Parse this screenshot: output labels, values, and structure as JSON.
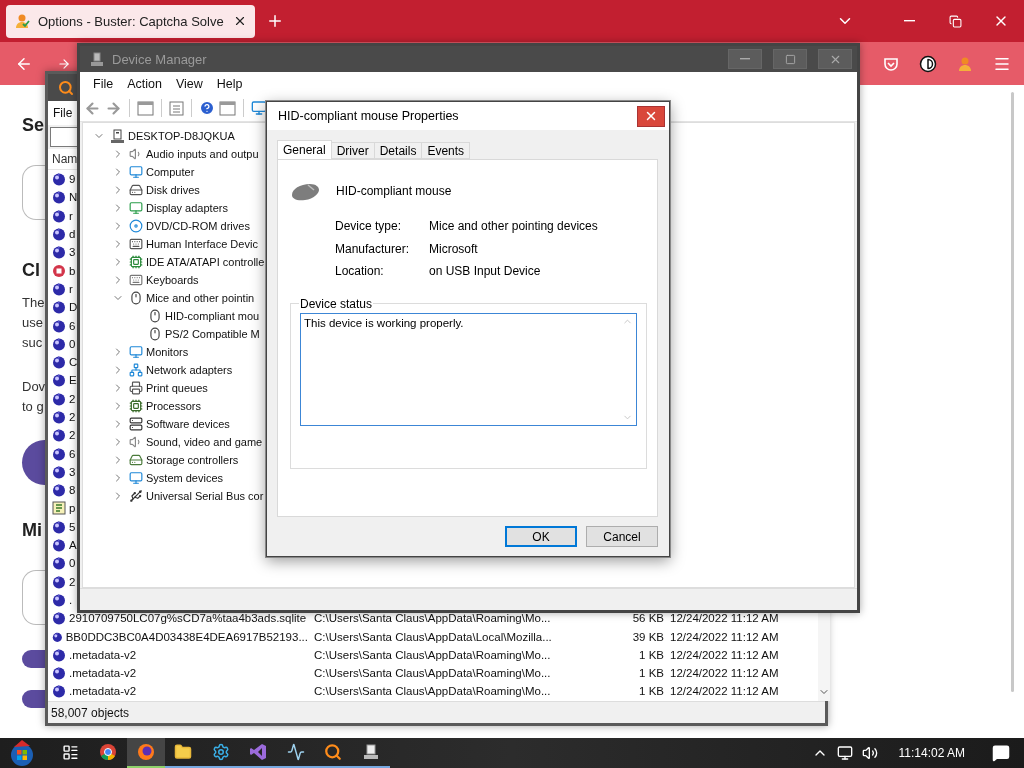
{
  "browser": {
    "tabs": [
      {
        "title": "Options - Buster: Captcha Solve",
        "selected": true
      }
    ],
    "page": {
      "heading_1": "Se",
      "heading_2": "Cl",
      "paragraph_1": [
        "The",
        "use",
        "suc"
      ],
      "paragraph_2": [
        "Dov",
        "to g"
      ],
      "heading_3": "Mi"
    }
  },
  "everything": {
    "menu": [
      "File"
    ],
    "columns": [
      "Nam"
    ],
    "rows": [
      {
        "kind": "database",
        "name": "9"
      },
      {
        "kind": "database",
        "name": "N"
      },
      {
        "kind": "database",
        "name": "r"
      },
      {
        "kind": "database",
        "name": "d"
      },
      {
        "kind": "database",
        "name": "3"
      },
      {
        "kind": "app",
        "name": "b"
      },
      {
        "kind": "database",
        "name": "r"
      },
      {
        "kind": "database",
        "name": "D"
      },
      {
        "kind": "database",
        "name": "6"
      },
      {
        "kind": "database",
        "name": "0"
      },
      {
        "kind": "database",
        "name": "C"
      },
      {
        "kind": "database",
        "name": "E"
      },
      {
        "kind": "database",
        "name": "2"
      },
      {
        "kind": "database",
        "name": "2"
      },
      {
        "kind": "database",
        "name": "2"
      },
      {
        "kind": "database",
        "name": "6"
      },
      {
        "kind": "database",
        "name": "3"
      },
      {
        "kind": "database",
        "name": "8"
      },
      {
        "kind": "script",
        "name": "p"
      },
      {
        "kind": "database",
        "name": "5"
      },
      {
        "kind": "database",
        "name": "A"
      },
      {
        "kind": "database",
        "name": "0"
      },
      {
        "kind": "database",
        "name": "2"
      },
      {
        "kind": "database",
        "name": "."
      },
      {
        "kind": "database",
        "name": "2910709750LC07g%sCD7a%taa4b3ads.sqlite",
        "path": "C:\\Users\\Santa Claus\\AppData\\Roaming\\Mo...",
        "size": "56 KB",
        "modified": "12/24/2022 11:12 AM"
      },
      {
        "kind": "database",
        "name": "BB0DDC3BC0A4D03438E4DEA6917B52193...",
        "path": "C:\\Users\\Santa Claus\\AppData\\Local\\Mozilla...",
        "size": "39 KB",
        "modified": "12/24/2022 11:12 AM"
      },
      {
        "kind": "database",
        "name": ".metadata-v2",
        "path": "C:\\Users\\Santa Claus\\AppData\\Roaming\\Mo...",
        "size": "1 KB",
        "modified": "12/24/2022 11:12 AM"
      },
      {
        "kind": "database",
        "name": ".metadata-v2",
        "path": "C:\\Users\\Santa Claus\\AppData\\Roaming\\Mo...",
        "size": "1 KB",
        "modified": "12/24/2022 11:12 AM"
      },
      {
        "kind": "database",
        "name": ".metadata-v2",
        "path": "C:\\Users\\Santa Claus\\AppData\\Roaming\\Mo...",
        "size": "1 KB",
        "modified": "12/24/2022 11:12 AM"
      }
    ],
    "status_bar": "58,007 objects"
  },
  "device_manager": {
    "title": "Device Manager",
    "menu": [
      "File",
      "Action",
      "View",
      "Help"
    ],
    "tree": {
      "label": "DESKTOP-D8JQKUA",
      "expanded": true,
      "children": [
        {
          "label": "Audio inputs and outpu",
          "expanded": false
        },
        {
          "label": "Computer",
          "expanded": false
        },
        {
          "label": "Disk drives",
          "expanded": false
        },
        {
          "label": "Display adapters",
          "expanded": false
        },
        {
          "label": "DVD/CD-ROM drives",
          "expanded": false
        },
        {
          "label": "Human Interface Devic",
          "expanded": false
        },
        {
          "label": "IDE ATA/ATAPI controlle",
          "expanded": false
        },
        {
          "label": "Keyboards",
          "expanded": false
        },
        {
          "label": "Mice and other pointin",
          "expanded": true,
          "children": [
            {
              "label": "HID-compliant mou"
            },
            {
              "label": "PS/2 Compatible M"
            }
          ]
        },
        {
          "label": "Monitors",
          "expanded": false
        },
        {
          "label": "Network adapters",
          "expanded": false
        },
        {
          "label": "Print queues",
          "expanded": false
        },
        {
          "label": "Processors",
          "expanded": false
        },
        {
          "label": "Software devices",
          "expanded": false
        },
        {
          "label": "Sound, video and game",
          "expanded": false
        },
        {
          "label": "Storage controllers",
          "expanded": false
        },
        {
          "label": "System devices",
          "expanded": false
        },
        {
          "label": "Universal Serial Bus cor",
          "expanded": false
        }
      ]
    }
  },
  "properties_dialog": {
    "title": "HID-compliant mouse Properties",
    "tabs": [
      {
        "label": "General",
        "selected": true
      },
      {
        "label": "Driver",
        "selected": false
      },
      {
        "label": "Details",
        "selected": false
      },
      {
        "label": "Events",
        "selected": false
      }
    ],
    "device_name": "HID-compliant mouse",
    "properties": [
      {
        "label": "Device type:",
        "value": "Mice and other pointing devices"
      },
      {
        "label": "Manufacturer:",
        "value": "Microsoft"
      },
      {
        "label": "Location:",
        "value": "on USB Input Device"
      }
    ],
    "device_status": {
      "label": "Device status",
      "text": "This device is working properly."
    },
    "buttons": [
      {
        "label": "OK",
        "default": true
      },
      {
        "label": "Cancel",
        "default": false
      }
    ]
  },
  "taskbar": {
    "apps": [
      {
        "selected": false,
        "running": false
      },
      {
        "selected": false,
        "running": false
      },
      {
        "selected": true,
        "running": true
      },
      {
        "selected": false,
        "running": true
      },
      {
        "selected": false,
        "running": true
      },
      {
        "selected": false,
        "running": true
      },
      {
        "selected": false,
        "running": true
      },
      {
        "selected": false,
        "running": true
      },
      {
        "selected": false,
        "running": true
      }
    ],
    "clock": "11:14:02 AM"
  }
}
